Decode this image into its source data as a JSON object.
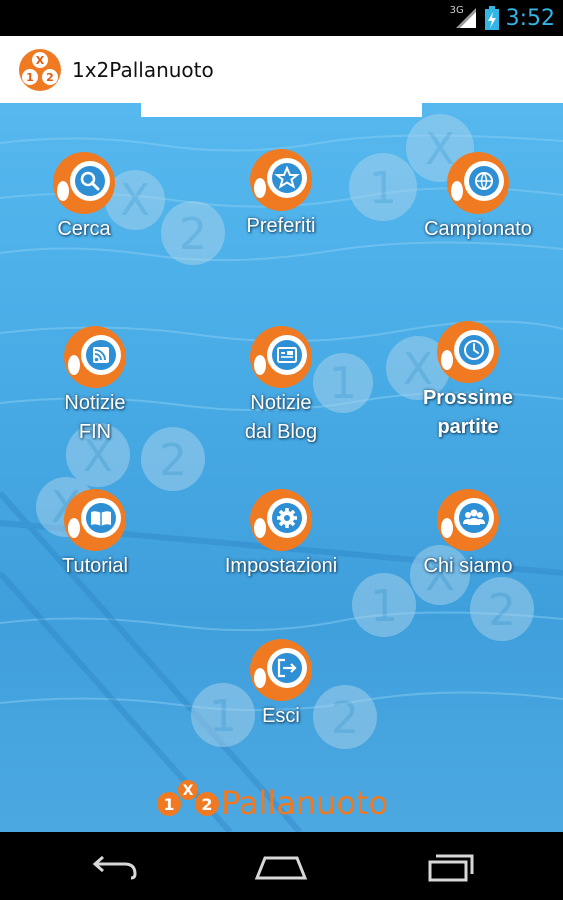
{
  "status_bar": {
    "network_type": "3G",
    "time": "3:52",
    "icons": [
      "signal-icon",
      "battery-charging-icon"
    ]
  },
  "action_bar": {
    "title": "1x2Pallanuoto",
    "logo_icon": "app-logo-icon"
  },
  "menu": {
    "items": [
      {
        "label": "Cerca",
        "icon": "search-icon"
      },
      {
        "label": "Preferiti",
        "icon": "star-icon"
      },
      {
        "label": "Campionato",
        "icon": "ball-icon"
      },
      {
        "label": "Notizie\nFIN",
        "icon": "rss-icon"
      },
      {
        "label": "Notizie\ndal Blog",
        "icon": "blog-icon"
      },
      {
        "label": "Prossime\npartite",
        "icon": "clock-icon"
      },
      {
        "label": "Tutorial",
        "icon": "book-icon"
      },
      {
        "label": "Impostazioni",
        "icon": "gear-icon"
      },
      {
        "label": "Chi siamo",
        "icon": "group-icon"
      },
      {
        "label": "Esci",
        "icon": "exit-icon"
      }
    ]
  },
  "brand": {
    "wordmark": "Pallanuoto",
    "digits": [
      "1",
      "X",
      "2"
    ]
  },
  "nav_bar": {
    "buttons": [
      "back-icon",
      "home-icon",
      "recent-apps-icon"
    ]
  },
  "colors": {
    "accent_orange": "#f07a22",
    "status_clock": "#33b5e5",
    "icon_blue": "#2f8fd4",
    "background_blue": "#4ca8e2"
  }
}
